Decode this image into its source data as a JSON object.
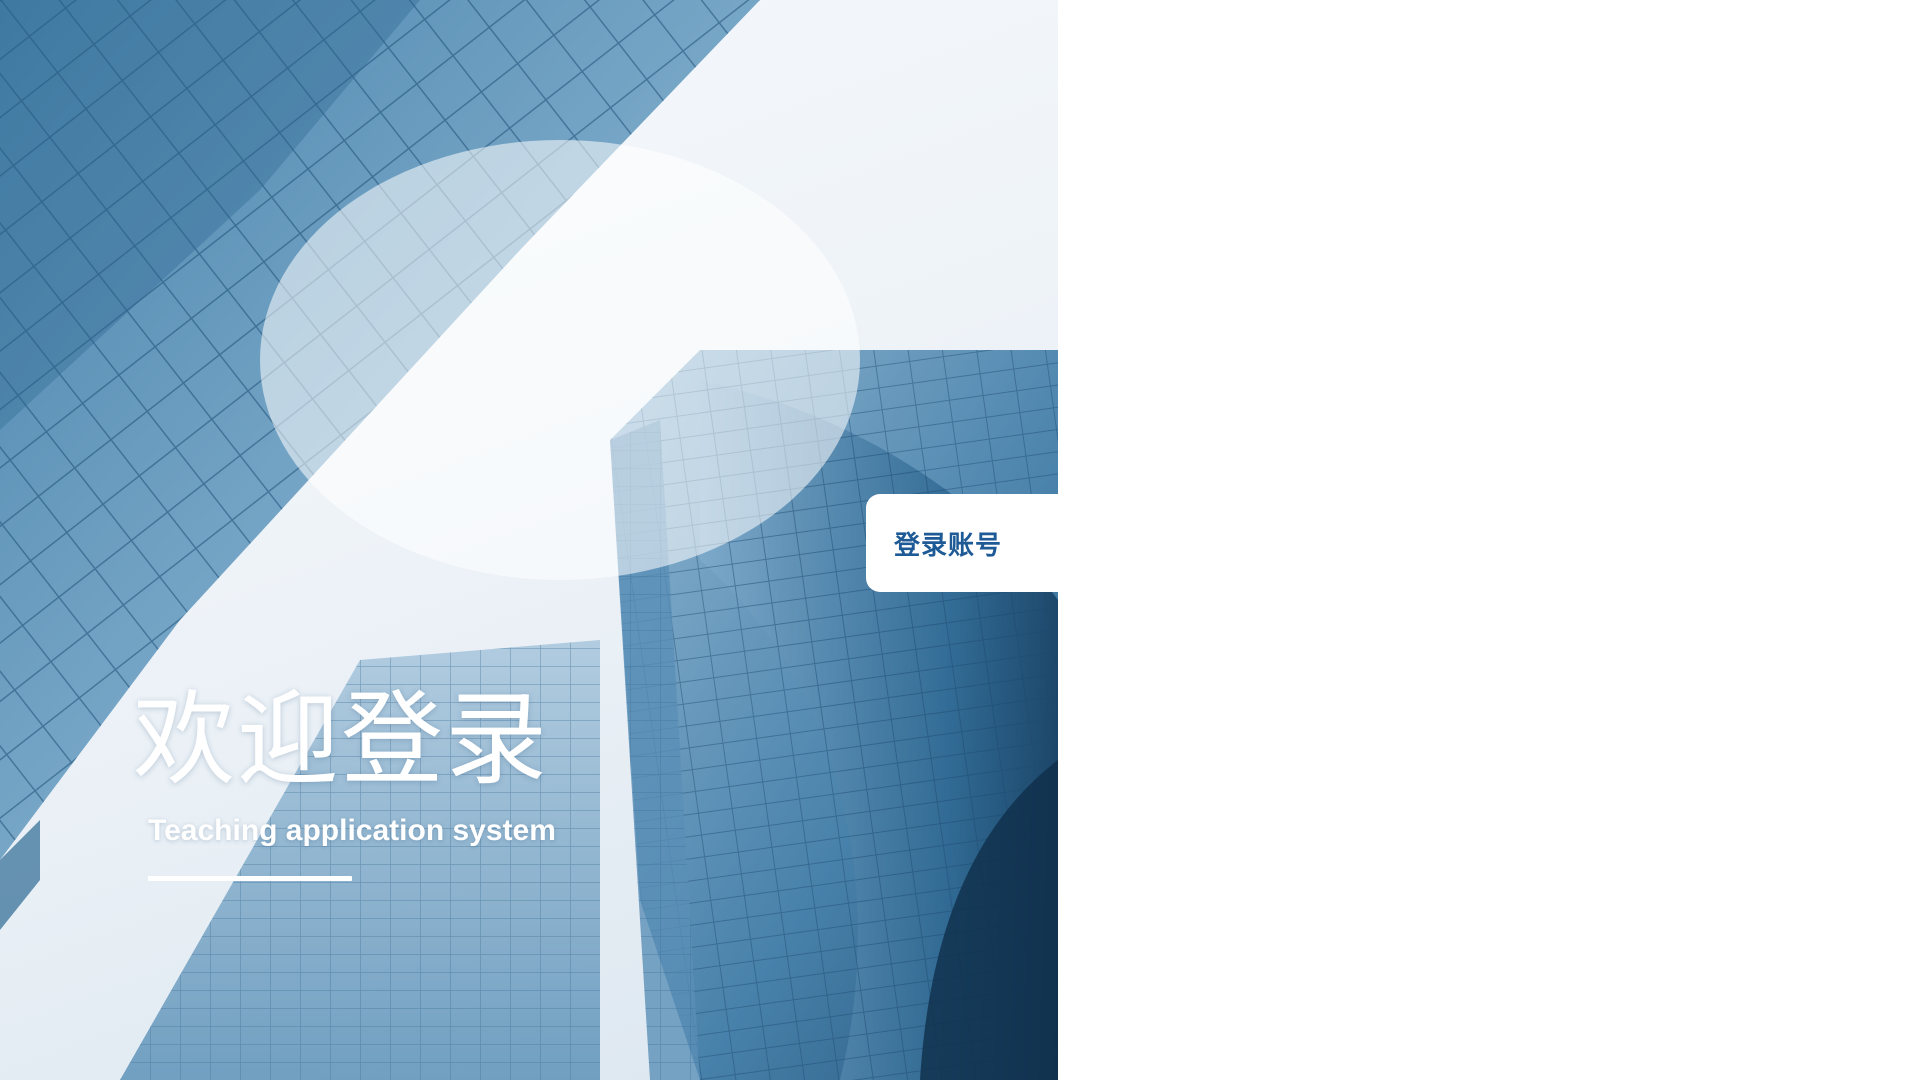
{
  "hero": {
    "title": "欢迎登录",
    "subtitle": "Teaching application system"
  },
  "tabs": {
    "login_label": "登录账号"
  },
  "colors": {
    "accent": "#1e5a96",
    "glass_dark": "#2f6e9a",
    "glass_light": "#a9c6dc",
    "sky": "#f4f8fb"
  }
}
